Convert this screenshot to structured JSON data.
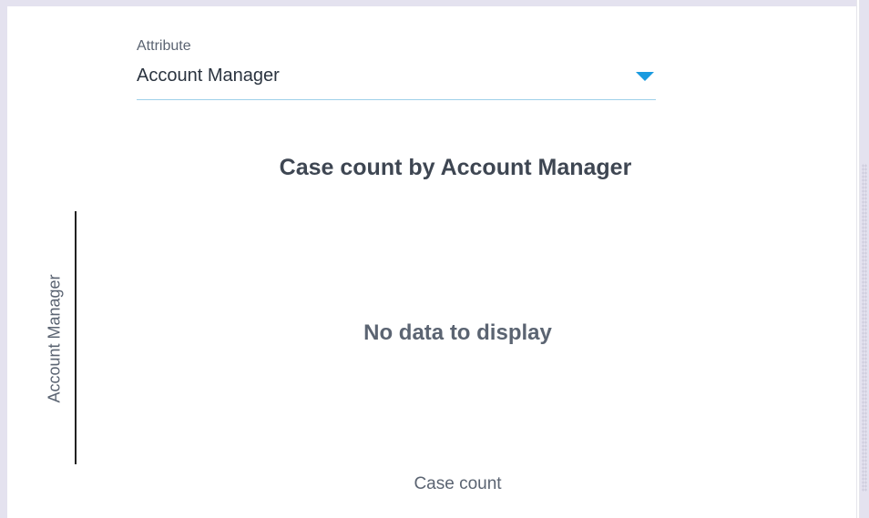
{
  "attribute": {
    "label": "Attribute",
    "value": "Account Manager"
  },
  "chart_data": {
    "type": "bar",
    "title": "Case count by Account Manager",
    "xlabel": "Case count",
    "ylabel": "Account Manager",
    "categories": [],
    "values": [],
    "empty_message": "No data to display"
  },
  "colors": {
    "accent": "#1a9be0",
    "underline": "#9fd0ea",
    "text_muted": "#5b6472",
    "background": "#e4e2ef"
  },
  "icons": {
    "dropdown": "caret-down-icon"
  }
}
